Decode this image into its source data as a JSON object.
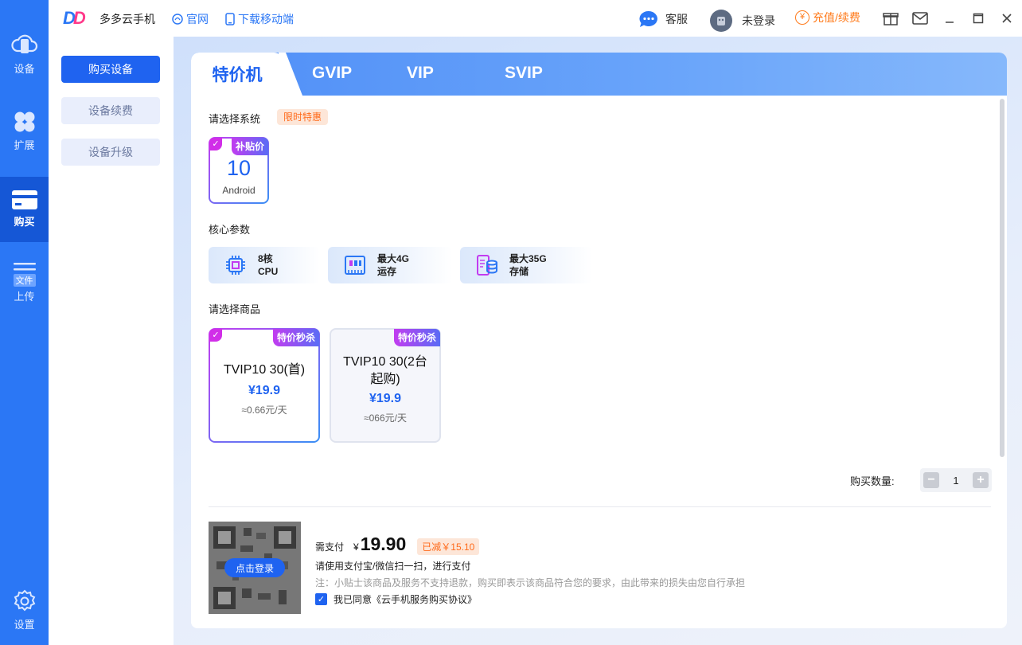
{
  "app": {
    "name": "多多云手机",
    "logo_text": "DD"
  },
  "topbar": {
    "links": [
      {
        "label": "官网",
        "icon": "globe-icon"
      },
      {
        "label": "下载移动端",
        "icon": "mobile-icon"
      }
    ],
    "service_label": "客服",
    "login_status": "未登录",
    "recharge_label": "充值/续费",
    "recharge_icon_glyph": "¥"
  },
  "rail": {
    "items": [
      {
        "label": "设备",
        "icon": "cloud-phone-icon"
      },
      {
        "label": "扩展",
        "icon": "clover-icon"
      },
      {
        "label": "购买",
        "icon": "card-icon",
        "active": true
      },
      {
        "label": "上传",
        "icon": "file-upload-icon",
        "badge": "文件"
      },
      {
        "label": "设置",
        "icon": "gear-icon"
      }
    ]
  },
  "submenu": {
    "items": [
      {
        "label": "购买设备",
        "active": true
      },
      {
        "label": "设备续费"
      },
      {
        "label": "设备升级"
      }
    ]
  },
  "tabs": [
    {
      "label": "特价机",
      "active": true
    },
    {
      "label": "GVIP"
    },
    {
      "label": "VIP"
    },
    {
      "label": "SVIP"
    }
  ],
  "system": {
    "title": "请选择系统",
    "badge": "限时特惠",
    "option": {
      "version": "10",
      "name": "Android",
      "tag": "补贴价",
      "selected": true
    }
  },
  "specs": {
    "title": "核心参数",
    "items": [
      {
        "line1": "8核",
        "line2": "CPU",
        "icon": "cpu-icon"
      },
      {
        "line1": "最大4G",
        "line2": "运存",
        "icon": "ram-icon"
      },
      {
        "line1": "最大35G",
        "line2": "存储",
        "icon": "storage-icon"
      }
    ]
  },
  "products": {
    "title": "请选择商品",
    "items": [
      {
        "name": "TVIP10 30(首)",
        "price": "¥19.9",
        "daily": "≈0.66元/天",
        "tag": "特价秒杀",
        "selected": true
      },
      {
        "name": "TVIP10 30(2台起购)",
        "price": "¥19.9",
        "daily": "≈066元/天",
        "tag": "特价秒杀",
        "selected": false
      }
    ]
  },
  "quantity": {
    "label": "购买数量:",
    "value": "1"
  },
  "payment": {
    "qr_button": "点击登录",
    "label": "需支付",
    "currency": "¥",
    "amount": "19.90",
    "saved": "已减￥15.10",
    "hint": "请使用支付宝/微信扫一扫，进行支付",
    "note": "注：小贴士该商品及服务不支持退款，购买即表示该商品符合您的要求，由此带来的损失由您自行承担",
    "agreement": "我已同意《云手机服务购买协议》",
    "agreed": true
  },
  "colors": {
    "rail": "#2b77f5",
    "accent": "#1f63f0",
    "discount": "#ff6a1a",
    "tag_gradient_start": "#c23cf0"
  }
}
